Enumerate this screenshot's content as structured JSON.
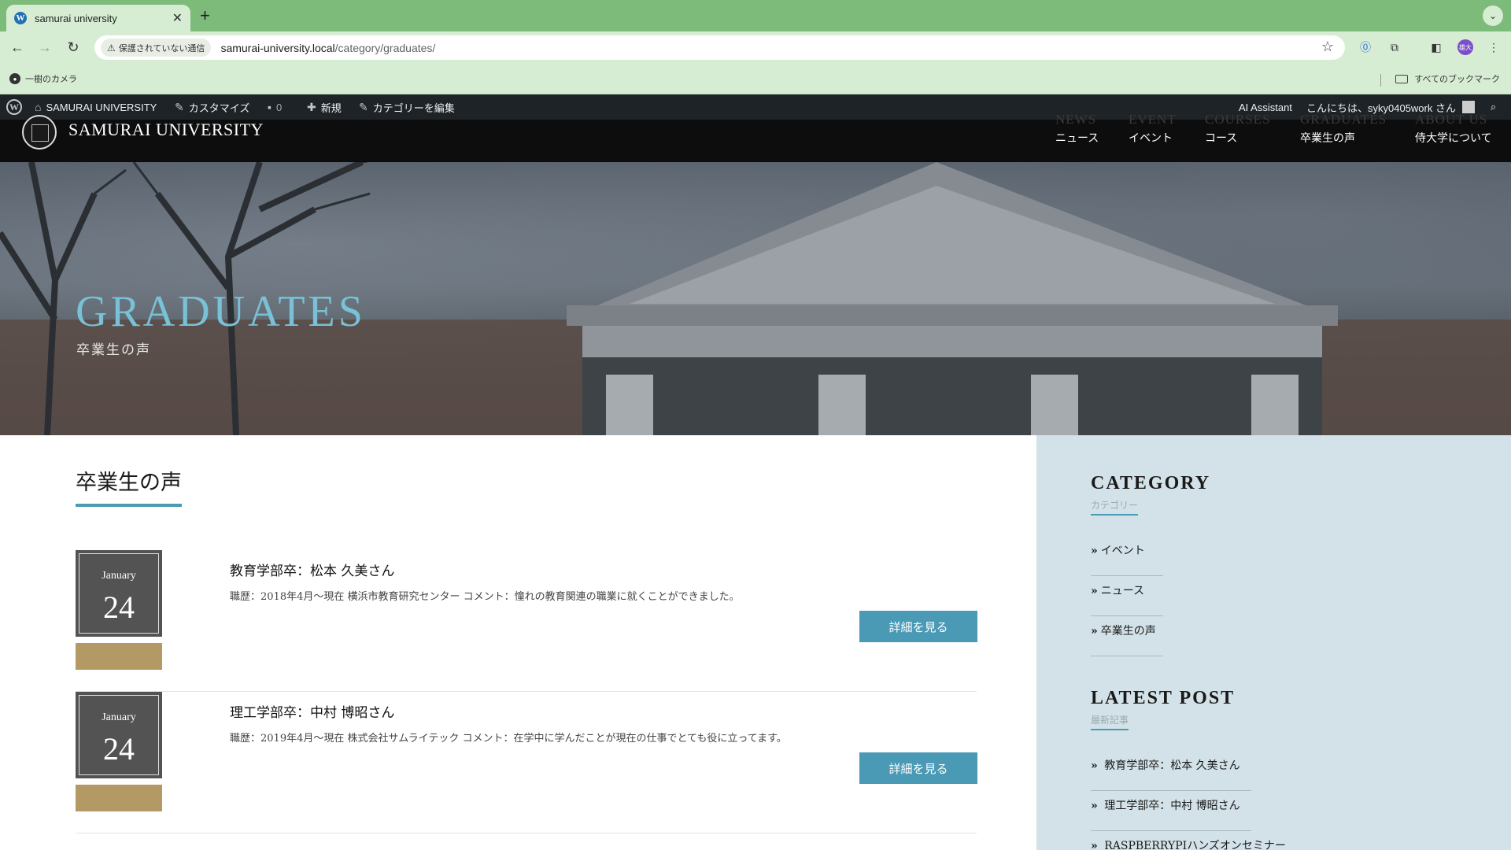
{
  "browser": {
    "tab_title": "samurai university",
    "security_label": "保護されていない通信",
    "url_host": "samurai-university.local",
    "url_path": "/category/graduates/",
    "bookmark": "一樹のカメラ",
    "all_bookmarks": "すべてのブックマーク",
    "profile_initials": "雄大"
  },
  "adminbar": {
    "site": "SAMURAI UNIVERSITY",
    "customize": "カスタマイズ",
    "comments_count": "0",
    "new": "新規",
    "edit_category": "カテゴリーを編集",
    "ai_assistant": "AI Assistant",
    "greeting": "こんにちは、syky0405work さん"
  },
  "header": {
    "site_name": "SAMURAI UNIVERSITY",
    "nav": [
      {
        "en": "NEWS",
        "ja": "ニュース"
      },
      {
        "en": "EVENT",
        "ja": "イベント"
      },
      {
        "en": "COURSES",
        "ja": "コース"
      },
      {
        "en": "GRADUATES",
        "ja": "卒業生の声"
      },
      {
        "en": "ABOUT US",
        "ja": "侍大学について"
      }
    ]
  },
  "hero": {
    "title": "GRADUATES",
    "subtitle": "卒業生の声"
  },
  "main": {
    "heading": "卒業生の声",
    "posts": [
      {
        "month": "January",
        "day": "24",
        "title": "教育学部卒：松本 久美さん",
        "excerpt": "職歴：2018年4月～現在 横浜市教育研究センター コメント：憧れの教育関連の職業に就くことができました。",
        "button": "詳細を見る"
      },
      {
        "month": "January",
        "day": "24",
        "title": "理工学部卒：中村 博昭さん",
        "excerpt": "職歴：2019年4月～現在 株式会社サムライテック コメント：在学中に学んだことが現在の仕事でとても役に立ってます。",
        "button": "詳細を見る"
      }
    ]
  },
  "sidebar": {
    "category_title": "CATEGORY",
    "category_sub": "カテゴリー",
    "categories": [
      "イベント",
      "ニュース",
      "卒業生の声"
    ],
    "latest_title": "LATEST POST",
    "latest_sub": "最新記事",
    "latest": [
      "教育学部卒：松本 久美さん",
      "理工学部卒：中村 博昭さん",
      "RASPBERRYPIハンズオンセミナー"
    ]
  },
  "colors": {
    "accent": "#4a9ab6",
    "hero_title": "#78c1d6",
    "date_tag": "#b39a65",
    "sidebar_bg": "#d3e2e8",
    "browser_frame": "#7dbb7a"
  }
}
